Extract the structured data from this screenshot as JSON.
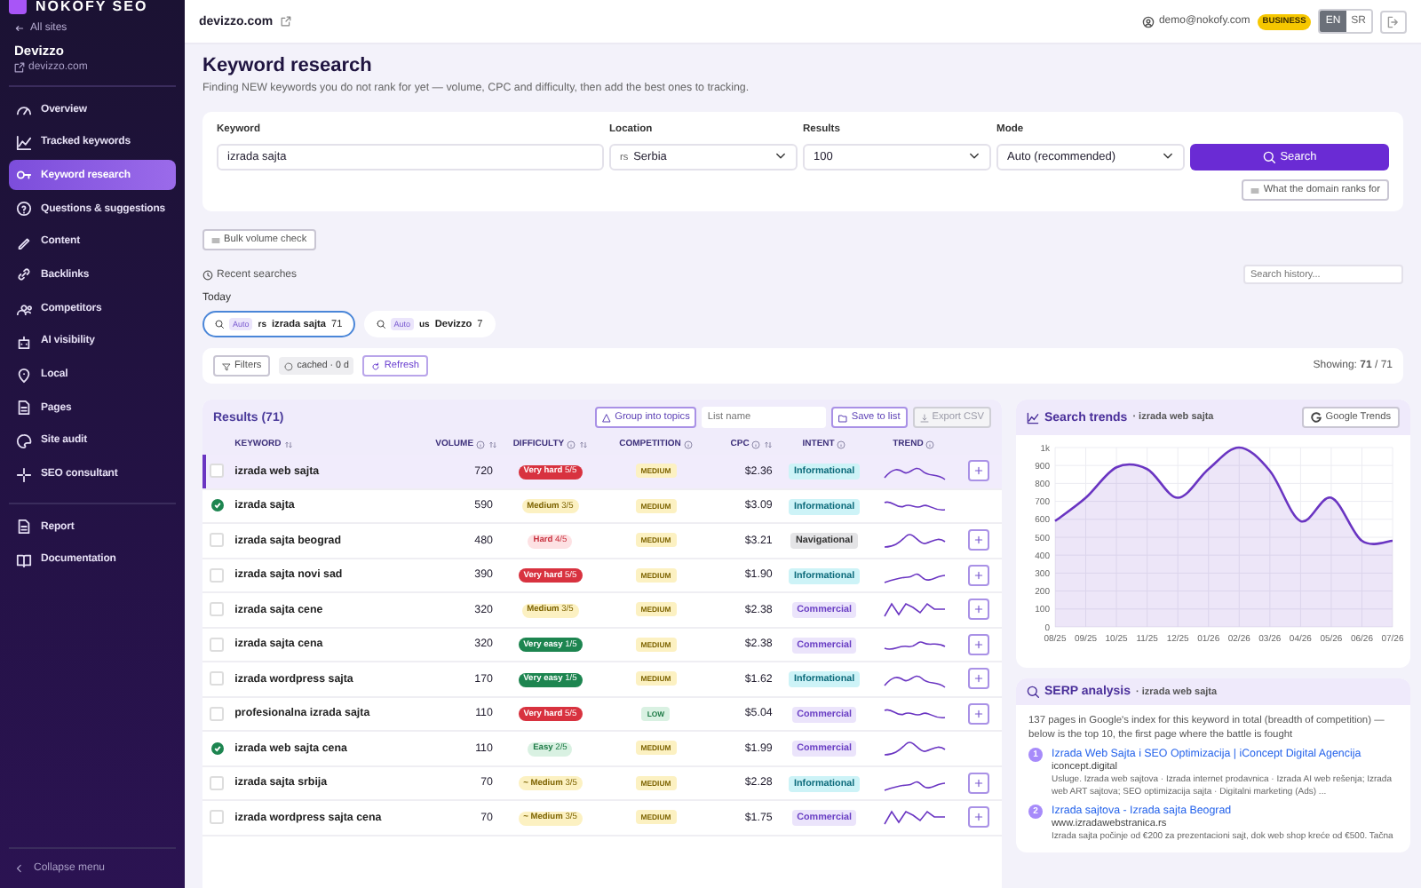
{
  "sidebar": {
    "logo": "NOKOFY SEO",
    "back": "All sites",
    "site": "Devizzo",
    "domain": "devizzo.com",
    "items": [
      {
        "label": "Overview",
        "selected": false
      },
      {
        "label": "Tracked keywords",
        "selected": false
      },
      {
        "label": "Keyword research",
        "selected": true
      },
      {
        "label": "Questions & suggestions",
        "selected": false
      },
      {
        "label": "Content",
        "selected": false
      },
      {
        "label": "Backlinks",
        "selected": false
      },
      {
        "label": "Competitors",
        "selected": false
      },
      {
        "label": "AI visibility",
        "selected": false
      },
      {
        "label": "Local",
        "selected": false
      },
      {
        "label": "Pages",
        "selected": false
      },
      {
        "label": "Site audit",
        "selected": false
      },
      {
        "label": "SEO consultant",
        "selected": false
      }
    ],
    "footer_items": [
      {
        "label": "Report",
        "selected": false
      },
      {
        "label": "Documentation",
        "selected": false
      }
    ],
    "collapse": "Collapse menu"
  },
  "header": {
    "domain": "devizzo.com",
    "user": "demo@nokofy.com",
    "plan": "BUSINESS",
    "languages": [
      {
        "label": "EN",
        "selected": true
      },
      {
        "label": "SR",
        "selected": false
      }
    ]
  },
  "page": {
    "title": "Keyword research",
    "subtitle": "Finding NEW keywords you do not rank for yet — volume, CPC and difficulty, then add the best ones to tracking."
  },
  "search_form": {
    "fields": [
      {
        "label": "Keyword",
        "value": "izrada sajta",
        "kind": "text"
      },
      {
        "label": "Location",
        "prefix": "rs",
        "value": "Serbia",
        "kind": "select"
      },
      {
        "label": "Results",
        "value": "100",
        "kind": "select"
      },
      {
        "label": "Mode",
        "value": "Auto (recommended)",
        "kind": "select"
      }
    ],
    "search_button": "Search",
    "domain_button": "What the domain ranks for"
  },
  "bulk_button": "Bulk volume check",
  "recent": {
    "title": "Recent searches",
    "search_placeholder": "Search history...",
    "group": "Today",
    "items": [
      {
        "mode": "Auto",
        "country": "rs",
        "keyword": "izrada sajta",
        "count": "71",
        "selected": true
      },
      {
        "mode": "Auto",
        "country": "us",
        "keyword": "Devizzo",
        "count": "7",
        "selected": false
      }
    ]
  },
  "filters": {
    "filters_button": "Filters",
    "cache": "cached · 0 d",
    "refresh": "Refresh",
    "showing": "Showing: **71** / 71"
  },
  "results": {
    "title": "Results (71)",
    "group_button": "Group into topics",
    "list_placeholder": "List name",
    "save_button": "Save to list",
    "export_button": {
      "label": "Export CSV",
      "disabled": true
    },
    "columns": [
      {
        "label": "KEYWORD",
        "info": false,
        "sortable": true
      },
      {
        "label": "VOLUME",
        "info": true,
        "sortable": true
      },
      {
        "label": "DIFFICULTY",
        "info": true,
        "sortable": true
      },
      {
        "label": "COMPETITION",
        "info": true,
        "sortable": false
      },
      {
        "label": "CPC",
        "info": true,
        "sortable": true
      },
      {
        "label": "INTENT",
        "info": true,
        "sortable": false
      },
      {
        "label": "TREND",
        "info": true,
        "sortable": false
      }
    ],
    "rows": [
      {
        "keyword": "izrada web sajta",
        "volume": "720",
        "difficulty": {
          "label": "Very hard",
          "score": "5/5",
          "kind": "very_hard"
        },
        "competition": {
          "label": "MEDIUM",
          "kind": "medium"
        },
        "cpc": "$2.36",
        "intent": {
          "label": "Informational",
          "kind": "informational"
        },
        "tracked": false,
        "selected": true
      },
      {
        "keyword": "izrada sajta",
        "volume": "590",
        "difficulty": {
          "label": "Medium",
          "score": "3/5",
          "kind": "medium"
        },
        "competition": {
          "label": "MEDIUM",
          "kind": "medium"
        },
        "cpc": "$3.09",
        "intent": {
          "label": "Informational",
          "kind": "informational"
        },
        "tracked": true,
        "selected": false
      },
      {
        "keyword": "izrada sajta beograd",
        "volume": "480",
        "difficulty": {
          "label": "Hard",
          "score": "4/5",
          "kind": "hard"
        },
        "competition": {
          "label": "MEDIUM",
          "kind": "medium"
        },
        "cpc": "$3.21",
        "intent": {
          "label": "Navigational",
          "kind": "navigational"
        },
        "tracked": false,
        "selected": false
      },
      {
        "keyword": "izrada sajta novi sad",
        "volume": "390",
        "difficulty": {
          "label": "Very hard",
          "score": "5/5",
          "kind": "very_hard"
        },
        "competition": {
          "label": "MEDIUM",
          "kind": "medium"
        },
        "cpc": "$1.90",
        "intent": {
          "label": "Informational",
          "kind": "informational"
        },
        "tracked": false,
        "selected": false
      },
      {
        "keyword": "izrada sajta cene",
        "volume": "320",
        "difficulty": {
          "label": "Medium",
          "score": "3/5",
          "kind": "medium"
        },
        "competition": {
          "label": "MEDIUM",
          "kind": "medium"
        },
        "cpc": "$2.38",
        "intent": {
          "label": "Commercial",
          "kind": "commercial"
        },
        "tracked": false,
        "selected": false
      },
      {
        "keyword": "izrada sajta cena",
        "volume": "320",
        "difficulty": {
          "label": "Very easy",
          "score": "1/5",
          "kind": "very_easy"
        },
        "competition": {
          "label": "MEDIUM",
          "kind": "medium"
        },
        "cpc": "$2.38",
        "intent": {
          "label": "Commercial",
          "kind": "commercial"
        },
        "tracked": false,
        "selected": false
      },
      {
        "keyword": "izrada wordpress sajta",
        "volume": "170",
        "difficulty": {
          "label": "Very easy",
          "score": "1/5",
          "kind": "very_easy"
        },
        "competition": {
          "label": "MEDIUM",
          "kind": "medium"
        },
        "cpc": "$1.62",
        "intent": {
          "label": "Informational",
          "kind": "informational"
        },
        "tracked": false,
        "selected": false
      },
      {
        "keyword": "profesionalna izrada sajta",
        "volume": "110",
        "difficulty": {
          "label": "Very hard",
          "score": "5/5",
          "kind": "very_hard"
        },
        "competition": {
          "label": "LOW",
          "kind": "low"
        },
        "cpc": "$5.04",
        "intent": {
          "label": "Commercial",
          "kind": "commercial"
        },
        "tracked": false,
        "selected": false
      },
      {
        "keyword": "izrada web sajta cena",
        "volume": "110",
        "difficulty": {
          "label": "Easy",
          "score": "2/5",
          "kind": "easy"
        },
        "competition": {
          "label": "MEDIUM",
          "kind": "medium"
        },
        "cpc": "$1.99",
        "intent": {
          "label": "Commercial",
          "kind": "commercial"
        },
        "tracked": true,
        "selected": false
      },
      {
        "keyword": "izrada sajta srbija",
        "volume": "70",
        "difficulty": {
          "label": "~ Medium",
          "score": "3/5",
          "kind": "medium"
        },
        "competition": {
          "label": "MEDIUM",
          "kind": "medium"
        },
        "cpc": "$2.28",
        "intent": {
          "label": "Informational",
          "kind": "informational"
        },
        "tracked": false,
        "selected": false
      },
      {
        "keyword": "izrada wordpress sajta cena",
        "volume": "70",
        "difficulty": {
          "label": "~ Medium",
          "score": "3/5",
          "kind": "medium"
        },
        "competition": {
          "label": "MEDIUM",
          "kind": "medium"
        },
        "cpc": "$1.75",
        "intent": {
          "label": "Commercial",
          "kind": "commercial"
        },
        "tracked": false,
        "selected": false
      }
    ]
  },
  "trends": {
    "title": "Search trends",
    "keyword": "· izrada web sajta",
    "button": "Google Trends",
    "chart_data": {
      "type": "area",
      "categories": [
        "08/25",
        "09/25",
        "10/25",
        "11/25",
        "12/25",
        "01/26",
        "02/26",
        "03/26",
        "04/26",
        "05/26",
        "06/26",
        "07/26"
      ],
      "series": [
        {
          "color": "#6a35c2",
          "values": [
            590,
            720,
            890,
            880,
            720,
            880,
            1000,
            870,
            590,
            720,
            480,
            480
          ]
        }
      ],
      "grid": true,
      "ylim": [
        0,
        1000
      ],
      "yticks": [
        0,
        100,
        200,
        300,
        400,
        500,
        600,
        700,
        800,
        900,
        {
          "value": 1000,
          "label": "1k"
        }
      ]
    }
  },
  "serp": {
    "title": "SERP analysis",
    "keyword": "· izrada web sajta",
    "summary": "137 pages in Google's index for this keyword in total (breadth of competition) — below is the top 10, the first page where the battle is fought",
    "results": [
      {
        "rank": "1",
        "title": "Izrada Web Sajta i SEO Optimizacija | iConcept Digital Agencija",
        "domain": "iconcept.digital",
        "snippet": "Usluge. Izrada web sajtova · Izrada internet prodavnica · Izrada AI web rešenja; Izrada web ART sajtova; SEO optimizacija sajta · Digitalni marketing (Ads) ..."
      },
      {
        "rank": "2",
        "title": "Izrada sajtova - Izrada sajta Beograd",
        "domain": "www.izradawebstranica.rs",
        "snippet": "Izrada sajta počinje od €200 za prezentacioni sajt, dok web shop kreće od €500. Tačna"
      }
    ]
  }
}
